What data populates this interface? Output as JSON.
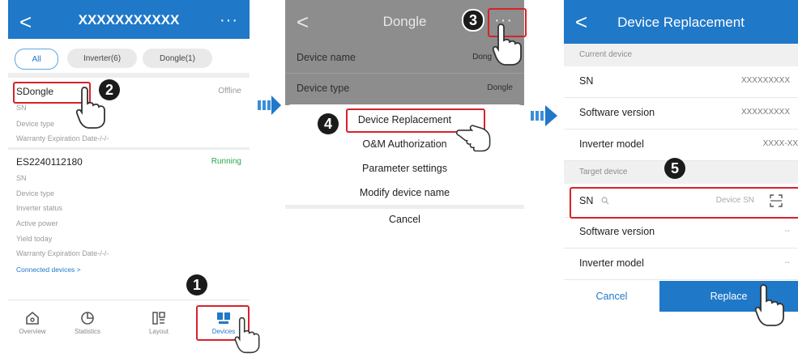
{
  "screen1": {
    "title": "XXXXXXXXXXX",
    "back": "<",
    "more": "···",
    "filters": [
      {
        "label": "All"
      },
      {
        "label": "Inverter(6)"
      },
      {
        "label": "Dongle(1)"
      }
    ],
    "dongle": {
      "name": "SDongle",
      "status": "Offline",
      "fields": [
        "SN",
        "Device type",
        "Warranty Expiration Date-/-/-"
      ]
    },
    "inverter": {
      "name": "ES2240112180",
      "status": "Running",
      "fields": [
        "SN",
        "Device type",
        "Inverter status",
        "Active power",
        "Yield today",
        "Warranty Expiration Date-/-/-"
      ],
      "link": "Connected devices >"
    },
    "nav": [
      {
        "label": "Overview",
        "icon": "home-icon"
      },
      {
        "label": "Statistics",
        "icon": "pie-chart-icon"
      },
      {
        "label": "Layout",
        "icon": "layout-icon"
      },
      {
        "label": "Devices",
        "icon": "devices-icon"
      }
    ]
  },
  "screen2": {
    "title": "Dongle",
    "back": "<",
    "more": "···",
    "rows": [
      {
        "label": "Device name",
        "value": "Dong"
      },
      {
        "label": "Device type",
        "value": "Dongle"
      }
    ],
    "menu": [
      "Device Replacement",
      "O&M Authorization",
      "Parameter settings",
      "Modify device name"
    ],
    "cancel": "Cancel"
  },
  "screen3": {
    "title": "Device Replacement",
    "back": "<",
    "current_section": "Current device",
    "current_rows": [
      {
        "label": "SN",
        "value": "XXXXXXXXX"
      },
      {
        "label": "Software version",
        "value": "XXXXXXXXX"
      },
      {
        "label": "Inverter model",
        "value": "XXXX-XX"
      }
    ],
    "target_section": "Target device",
    "sn_label": "SN",
    "sn_placeholder": "Device SN",
    "target_rows": [
      {
        "label": "Software version",
        "value": "--"
      },
      {
        "label": "Inverter model",
        "value": "--"
      }
    ],
    "cancel": "Cancel",
    "replace": "Replace"
  },
  "steps": [
    "1",
    "2",
    "3",
    "4",
    "5"
  ],
  "colors": {
    "accent": "#1f78c8",
    "highlight": "#d7222a",
    "running": "#2aa84a"
  }
}
